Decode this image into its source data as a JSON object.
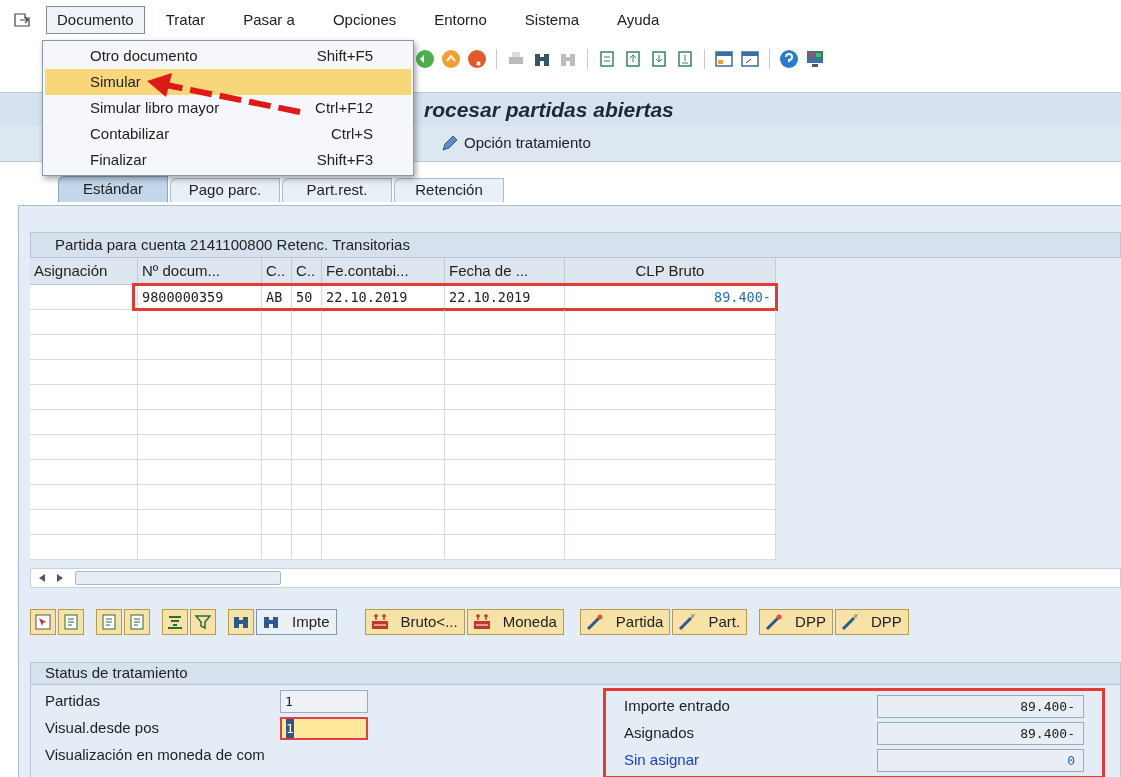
{
  "menu_bar": {
    "items": [
      {
        "label": "Documento",
        "selected": true
      },
      {
        "label": "Tratar",
        "selected": false
      },
      {
        "label": "Pasar a",
        "selected": false
      },
      {
        "label": "Opciones",
        "selected": false
      },
      {
        "label": "Entorno",
        "selected": false
      },
      {
        "label": "Sistema",
        "selected": false
      },
      {
        "label": "Ayuda",
        "selected": false
      }
    ]
  },
  "dropdown_menu": {
    "items": [
      {
        "label": "Otro documento",
        "shortcut": "Shift+F5",
        "selected": false
      },
      {
        "label": "Simular",
        "selected": true
      },
      {
        "label": "Simular libro mayor",
        "shortcut": "Ctrl+F12",
        "selected": false
      },
      {
        "label": "Contabilizar",
        "shortcut": "Ctrl+S",
        "selected": false
      },
      {
        "label": "Finalizar",
        "shortcut": "Shift+F3",
        "selected": false
      }
    ]
  },
  "title": "rocesar partidas abiertas",
  "application_toolbar": {
    "items": [
      {
        "label": "Opción tratamiento"
      }
    ]
  },
  "tabs": [
    {
      "label": "Estándar",
      "selected": true
    },
    {
      "label": "Pago parc.",
      "selected": false
    },
    {
      "label": "Part.rest.",
      "selected": false
    },
    {
      "label": "Retención",
      "selected": false
    }
  ],
  "table": {
    "caption": "Partida para cuenta 2141100800 Retenc. Transitorias",
    "columns": [
      "Asignación",
      "Nº docum...",
      "C..",
      "C..",
      "Fe.contabi...",
      "Fecha de ...",
      "CLP Bruto"
    ],
    "rows": [
      {
        "cells": [
          "",
          "9800000359",
          "AB",
          "50",
          "22.10.2019",
          "22.10.2019",
          "89.400-"
        ],
        "highlighted": true
      }
    ]
  },
  "buttons": [
    {
      "label": "Impte",
      "kind": "find"
    },
    {
      "label": "Bruto<...",
      "kind": "money"
    },
    {
      "label": "Moneda",
      "kind": "money"
    },
    {
      "label": "Partida",
      "kind": "wand"
    },
    {
      "label": "Part.",
      "kind": "wand2"
    },
    {
      "label": "DPP",
      "kind": "wand"
    },
    {
      "label": "DPP",
      "kind": "wand2"
    }
  ],
  "status": {
    "title": "Status de tratamiento",
    "left": [
      {
        "label": "Partidas",
        "value": "1",
        "focused": false
      },
      {
        "label": "Visual.desde pos",
        "value": "1",
        "focused": true
      },
      {
        "label": "Visualización en moneda de com"
      }
    ],
    "right": [
      {
        "label": "Importe entrado",
        "value": "89.400-",
        "link": false
      },
      {
        "label": "Asignados",
        "value": "89.400-",
        "link": false
      },
      {
        "label": "Sin asignar",
        "value": "0",
        "link": true
      }
    ]
  }
}
